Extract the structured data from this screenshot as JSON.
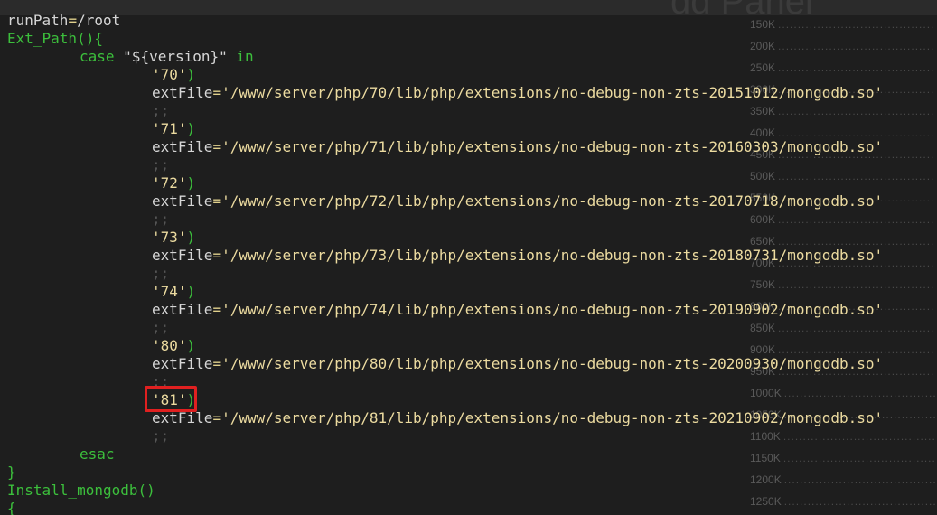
{
  "background": {
    "title_fragment": "dd Panel",
    "scale_labels": [
      "150K",
      "200K",
      "250K",
      "300K",
      "350K",
      "400K",
      "450K",
      "500K",
      "550K",
      "600K",
      "650K",
      "700K",
      "750K",
      "800K",
      "850K",
      "900K",
      "950K",
      "1000K",
      "1050K",
      "1100K",
      "1150K",
      "1200K",
      "1250K"
    ]
  },
  "code": {
    "line1_var": "runPath",
    "line1_eq": "=",
    "line1_val": "/root",
    "func1_name": "Ext_Path(){",
    "case_kw": "case",
    "case_expr": "\"${version}\"",
    "in_kw": "in",
    "var_name": "extFile",
    "eq": "=",
    "paren": ")",
    "semis": ";;",
    "entries": [
      {
        "version": "'70'",
        "path": "'/www/server/php/70/lib/php/extensions/no-debug-non-zts-20151012/mongodb.so'"
      },
      {
        "version": "'71'",
        "path": "'/www/server/php/71/lib/php/extensions/no-debug-non-zts-20160303/mongodb.so'"
      },
      {
        "version": "'72'",
        "path": "'/www/server/php/72/lib/php/extensions/no-debug-non-zts-20170718/mongodb.so'"
      },
      {
        "version": "'73'",
        "path": "'/www/server/php/73/lib/php/extensions/no-debug-non-zts-20180731/mongodb.so'"
      },
      {
        "version": "'74'",
        "path": "'/www/server/php/74/lib/php/extensions/no-debug-non-zts-20190902/mongodb.so'"
      },
      {
        "version": "'80'",
        "path": "'/www/server/php/80/lib/php/extensions/no-debug-non-zts-20200930/mongodb.so'"
      },
      {
        "version": "'81'",
        "path": "'/www/server/php/81/lib/php/extensions/no-debug-non-zts-20210902/mongodb.so'"
      }
    ],
    "esac_kw": "esac",
    "close_brace": "}",
    "func2_name": "Install_mongodb()",
    "open_brace": "{"
  },
  "colors": {
    "background": "#1e1e1e",
    "keyword_green": "#3cbf3c",
    "string_yellow": "#ecdba0",
    "highlight_red": "#e02020"
  }
}
